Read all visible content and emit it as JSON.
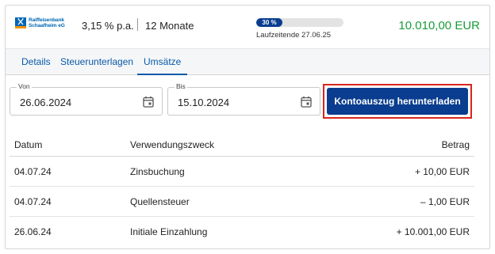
{
  "header": {
    "bank_name_line1": "Raiffeisenbank",
    "bank_name_line2": "Schaafheim eG",
    "interest_rate": "3,15 % p.a.",
    "term": "12 Monate",
    "progress_label": "30 %",
    "progress_fraction": 0.3,
    "runtime_text": "Laufzeitende 27.06.25",
    "balance": "10.010,00 EUR"
  },
  "tabs": [
    {
      "label": "Details"
    },
    {
      "label": "Steuerunterlagen"
    },
    {
      "label": "Umsätze",
      "active": true
    }
  ],
  "filters": {
    "from_label": "Von",
    "from_value": "26.06.2024",
    "to_label": "Bis",
    "to_value": "15.10.2024",
    "download_button": "Kontoauszug herunterladen"
  },
  "table": {
    "headers": {
      "date": "Datum",
      "purpose": "Verwendungszweck",
      "amount": "Betrag"
    },
    "rows": [
      {
        "date": "04.07.24",
        "purpose": "Zinsbuchung",
        "amount": "+ 10,00 EUR"
      },
      {
        "date": "04.07.24",
        "purpose": "Quellensteuer",
        "amount": "– 1,00 EUR"
      },
      {
        "date": "26.06.24",
        "purpose": "Initiale Einzahlung",
        "amount": "+ 10.001,00 EUR"
      }
    ]
  },
  "colors": {
    "accent": "#0a3d8f",
    "balance_green": "#1a9c3b",
    "highlight_red": "#d8261c",
    "tab_link": "#0a5aa8"
  },
  "icons": {
    "bank_logo": "raiffeisen-logo",
    "date_picker": "calendar-icon"
  }
}
